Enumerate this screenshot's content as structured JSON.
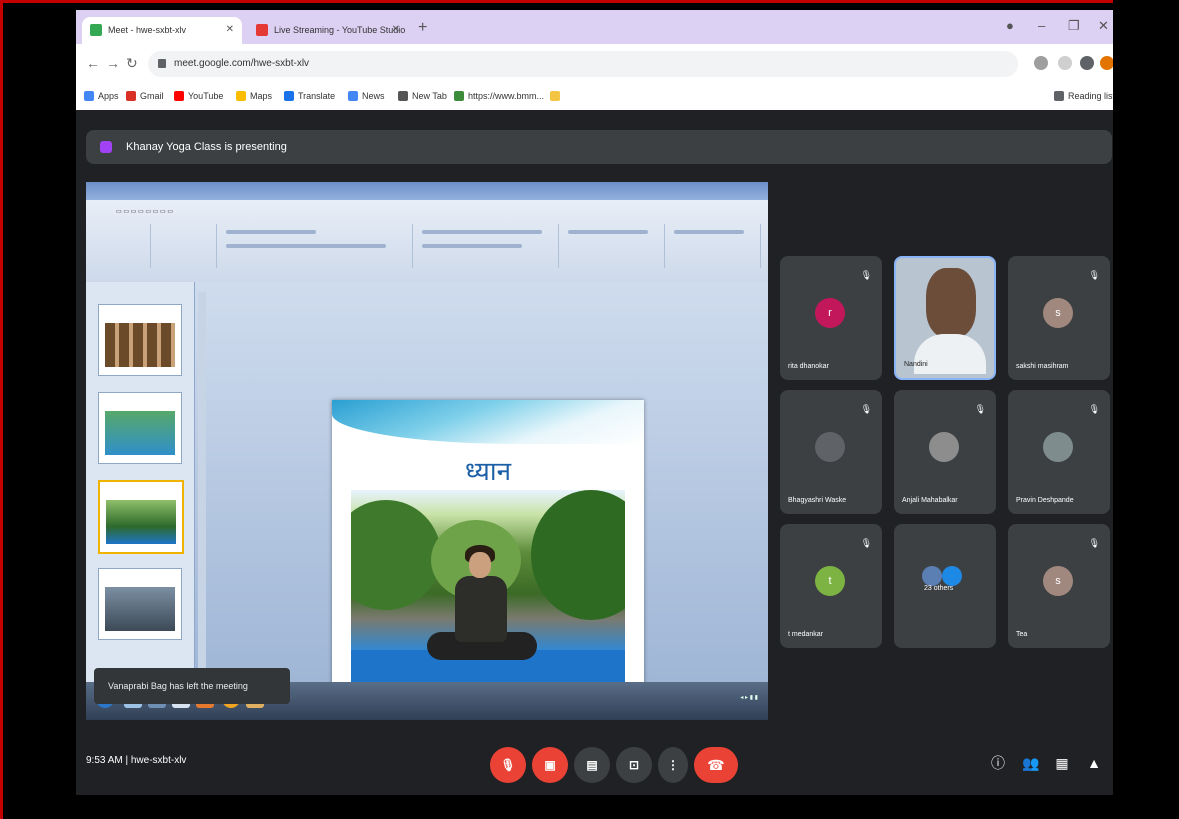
{
  "browser": {
    "tabs": [
      {
        "label": "Meet - hwe-sxbt-xlv",
        "active": true
      },
      {
        "label": "Live Streaming - YouTube Studio",
        "active": false
      }
    ],
    "url": "meet.google.com/hwe-sxbt-xlv",
    "bookmarks": [
      "Apps",
      "Gmail",
      "YouTube",
      "Maps",
      "Translate",
      "News",
      "New Tab",
      "https://www.bmm...",
      "Reading list"
    ]
  },
  "meet": {
    "banner": "Khanay Yoga Class is presenting",
    "slide_title": "ध्यान",
    "toast": "Vanaprabi Bag has left the meeting",
    "meeting_time": "9:53 AM",
    "meeting_code": "hwe-sxbt-xlv",
    "participants": [
      {
        "name": "rita dhanokar",
        "initial": "r",
        "color": "#c2185b"
      },
      {
        "name": "Nandini",
        "initial": "",
        "color": "#b8c4cf"
      },
      {
        "name": "sakshi masihram",
        "initial": "s",
        "color": "#a1887f"
      },
      {
        "name": "Bhagyashri Waske",
        "initial": "",
        "color": "#5f6368"
      },
      {
        "name": "Anjali Mahabalkar",
        "initial": "",
        "color": "#8d8d8d"
      },
      {
        "name": "Pravin Deshpande",
        "initial": "",
        "color": "#7f8c8d"
      },
      {
        "name": "t medankar",
        "initial": "t",
        "color": "#7cb342"
      },
      {
        "name": "23 others",
        "initial": "",
        "color": "#5c7fb3"
      },
      {
        "name": "Tea",
        "initial": "s",
        "color": "#a1887f"
      }
    ]
  },
  "icons": [
    "mic-off-icon",
    "camera-off-icon",
    "captions-icon",
    "present-icon",
    "more-icon",
    "end-call-icon",
    "info-icon",
    "people-icon",
    "chat-icon",
    "activities-icon"
  ]
}
